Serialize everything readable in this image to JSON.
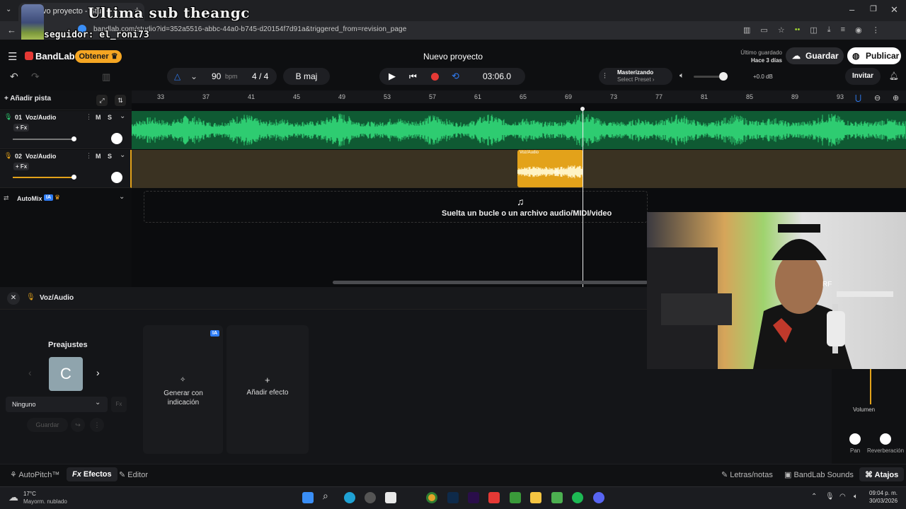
{
  "browser": {
    "tab_title": "vo proyecto - Stu",
    "url": "bandlab.com/studio?id=352a5516-abbc-44a0-b745-d20154f7d91a&triggered_from=revision_page",
    "overlay_title": "Ultima sub  theangc",
    "overlay_sub": "seguidor: el_roni73"
  },
  "header": {
    "logo": "BandLab",
    "get_button": "Obtener",
    "project_title": "Nuevo proyecto",
    "last_saved_label": "Último guardado",
    "last_saved_value": "Hace 3 días",
    "save_button": "Guardar",
    "publish_button": "Publicar"
  },
  "transport": {
    "bpm": "90",
    "bpm_unit": "bpm",
    "time_sig": "4 / 4",
    "key": "B maj",
    "time": "03:06.0",
    "mastering_label": "Masterizando",
    "mastering_preset": "Select Preset",
    "volume_db": "+0.0 dB",
    "invite": "Invitar"
  },
  "ruler": [
    "33",
    "37",
    "41",
    "45",
    "49",
    "53",
    "57",
    "61",
    "65",
    "69",
    "73",
    "77",
    "81",
    "85",
    "89",
    "93"
  ],
  "tracks": {
    "add_track": "Añadir pista",
    "t1": {
      "num": "01",
      "name": "Voz/Audio",
      "fx": "+ Fx",
      "m": "M",
      "s": "S"
    },
    "t2": {
      "num": "02",
      "name": "Voz/Audio",
      "fx": "+ Fx",
      "m": "M",
      "s": "S",
      "clip_label": "Voz/Audio"
    },
    "automix": "AutoMix",
    "ia": "IA",
    "drop_hint": "Suelta un bucle o un archivo audio/MIDI/video"
  },
  "panel": {
    "track_name": "Voz/Audio",
    "presets_title": "Preajustes",
    "preset_letter": "C",
    "preset_select": "Ninguno",
    "save": "Guardar",
    "ia_badge": "IA",
    "generate": "Generar con indicación",
    "add_effect": "Añadir efecto",
    "volume": "Volumen",
    "pan": "Pan",
    "reverb": "Reverberación"
  },
  "footer": {
    "autopitch": "AutoPitch™",
    "effects": "Efectos",
    "editor": "Editor",
    "lyrics": "Letras/notas",
    "sounds": "BandLab Sounds",
    "shortcuts": "Atajos"
  },
  "taskbar": {
    "temp": "17°C",
    "weather": "Mayorm. nublado",
    "time": "09:04 p. m.",
    "date": "30/03/2026"
  },
  "colors": {
    "accent": "#f5a623",
    "track1_wave": "#2ecc71",
    "track2_clip": "#e3a21a",
    "record": "#e53935",
    "loop": "#2f7df6"
  }
}
